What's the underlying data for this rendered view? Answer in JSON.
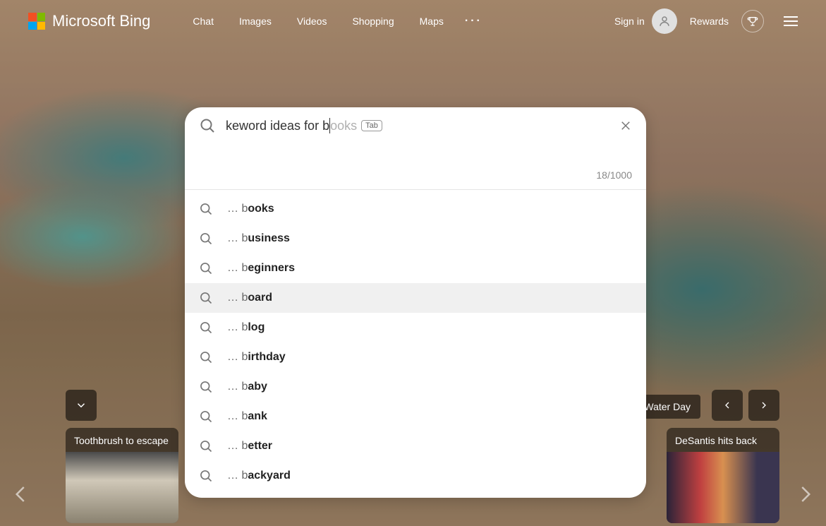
{
  "brand": "Microsoft Bing",
  "nav": {
    "items": [
      "Chat",
      "Images",
      "Videos",
      "Shopping",
      "Maps"
    ]
  },
  "header": {
    "signin": "Sign in",
    "rewards": "Rewards"
  },
  "search": {
    "typed_prefix": "keword ideas for b",
    "ghost_suffix": "ooks",
    "tab_label": "Tab",
    "char_count": "18/1000"
  },
  "suggestions": [
    {
      "prefix": "… b",
      "bold": "ooks",
      "hovered": false
    },
    {
      "prefix": "… b",
      "bold": "usiness",
      "hovered": false
    },
    {
      "prefix": "… b",
      "bold": "eginners",
      "hovered": false
    },
    {
      "prefix": "… b",
      "bold": "oard",
      "hovered": true
    },
    {
      "prefix": "… b",
      "bold": "log",
      "hovered": false
    },
    {
      "prefix": "… b",
      "bold": "irthday",
      "hovered": false
    },
    {
      "prefix": "… b",
      "bold": "aby",
      "hovered": false
    },
    {
      "prefix": "… b",
      "bold": "ank",
      "hovered": false
    },
    {
      "prefix": "… b",
      "bold": "etter",
      "hovered": false
    },
    {
      "prefix": "… b",
      "bold": "ackyard",
      "hovered": false
    }
  ],
  "trending": {
    "pill_right": "d Water Day",
    "card_left_title": "Toothbrush to escape",
    "card_right_title": "DeSantis hits back"
  }
}
